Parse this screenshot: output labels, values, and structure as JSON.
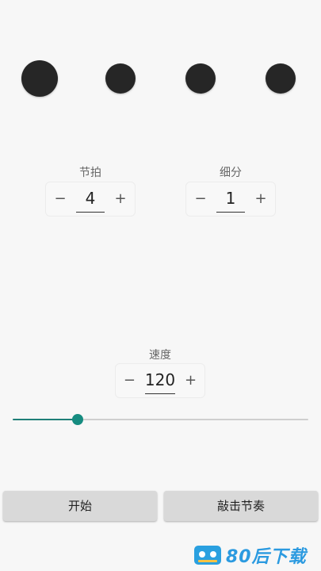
{
  "beats": {
    "count": 4,
    "accent_index": 0,
    "color": "#262626"
  },
  "beat_group": {
    "label": "节拍",
    "minus": "−",
    "value": "4",
    "plus": "+"
  },
  "subdivision_group": {
    "label": "细分",
    "minus": "−",
    "value": "1",
    "plus": "+"
  },
  "tempo_group": {
    "label": "速度",
    "minus": "−",
    "value": "120",
    "plus": "+"
  },
  "slider": {
    "fraction": 0.22,
    "accent": "#168c80"
  },
  "buttons": {
    "start": "开始",
    "tap": "敲击节奏"
  },
  "watermark": {
    "text": "80后下载",
    "icon": "cassette-icon",
    "color": "#2b9ae0"
  }
}
